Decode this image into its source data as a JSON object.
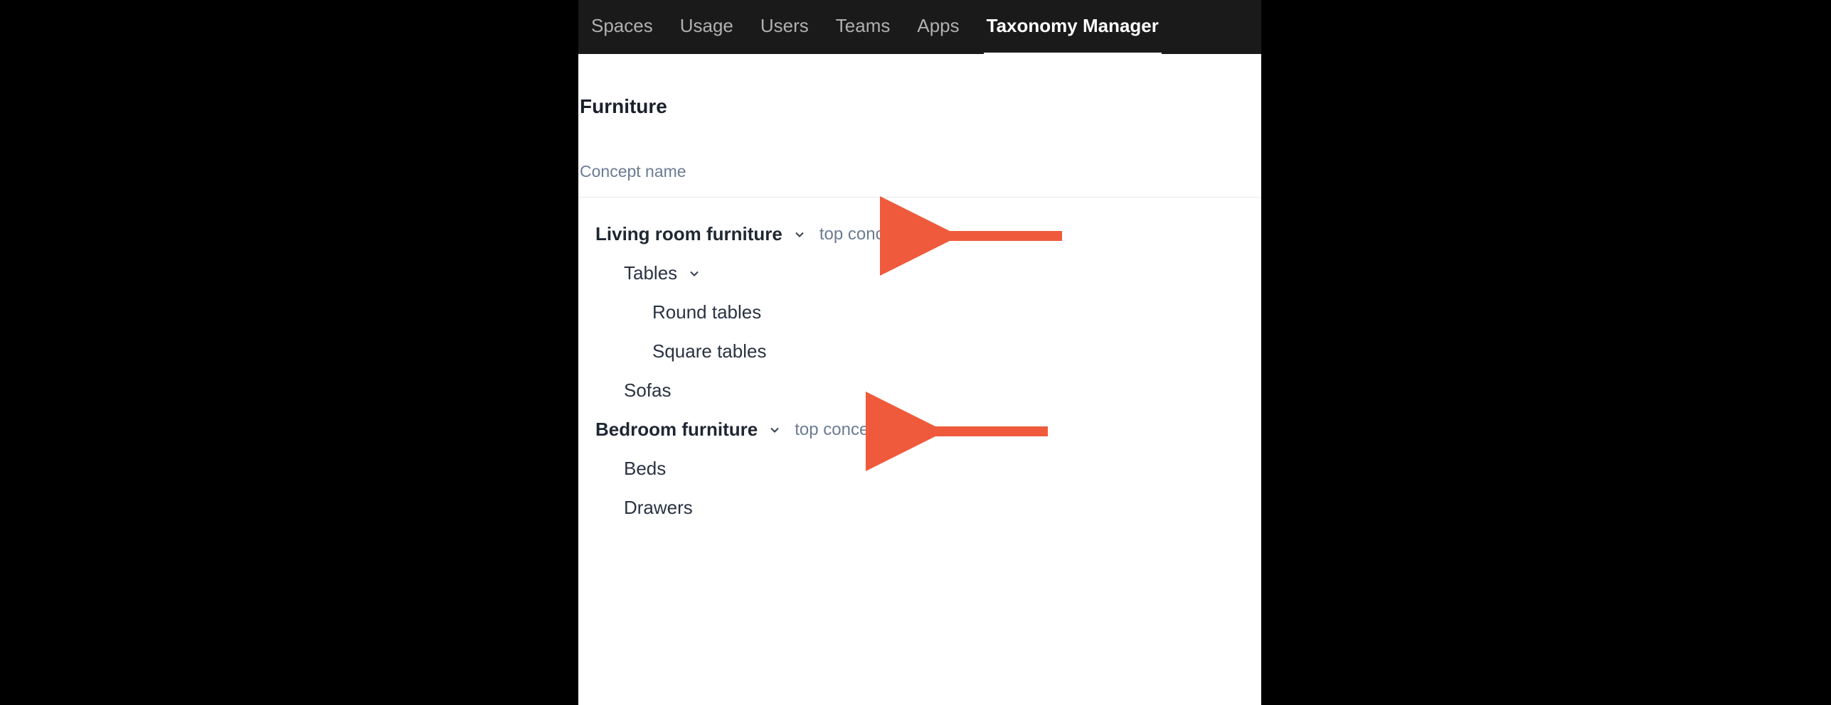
{
  "nav": {
    "items": [
      {
        "label": "Spaces",
        "active": false
      },
      {
        "label": "Usage",
        "active": false
      },
      {
        "label": "Users",
        "active": false
      },
      {
        "label": "Teams",
        "active": false
      },
      {
        "label": "Apps",
        "active": false
      },
      {
        "label": "Taxonomy Manager",
        "active": true
      }
    ]
  },
  "page": {
    "title": "Furniture",
    "column_header": "Concept name"
  },
  "badges": {
    "top_concept": "top concept"
  },
  "tree": {
    "living_room": {
      "label": "Living room furniture",
      "tables": {
        "label": "Tables",
        "round": "Round tables",
        "square": "Square tables"
      },
      "sofas": "Sofas"
    },
    "bedroom": {
      "label": "Bedroom furniture",
      "beds": "Beds",
      "drawers": "Drawers"
    }
  },
  "annotations": {
    "arrow_color": "#f05a3c"
  }
}
